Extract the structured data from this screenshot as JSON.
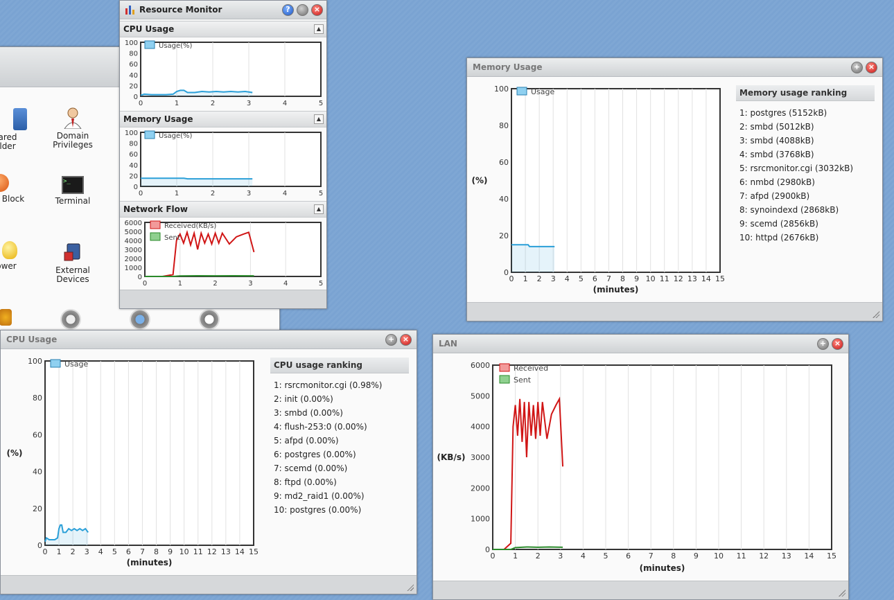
{
  "resource_monitor": {
    "title": "Resource Monitor",
    "sections": {
      "cpu": "CPU Usage",
      "memory": "Memory Usage",
      "network": "Network Flow"
    }
  },
  "desktop": {
    "icons": [
      {
        "name": "shared-folder",
        "line1": "ared",
        "line2": "lder"
      },
      {
        "name": "domain-privileges",
        "line1": "Domain",
        "line2": "Privileges"
      },
      {
        "name": "block",
        "line1": "Block",
        "line2": ""
      },
      {
        "name": "terminal",
        "line1": "Terminal",
        "line2": ""
      },
      {
        "name": "power",
        "line1": "ower",
        "line2": ""
      },
      {
        "name": "external-devices",
        "line1": "External",
        "line2": "Devices"
      }
    ]
  },
  "memory_window": {
    "title": "Memory Usage",
    "ranking_title": "Memory usage ranking",
    "ranking": [
      "1: postgres (5152kB)",
      "2: smbd (5012kB)",
      "3: smbd (4088kB)",
      "4: smbd (3768kB)",
      "5: rsrcmonitor.cgi (3032kB)",
      "6: nmbd (2980kB)",
      "7: afpd (2900kB)",
      "8: synoindexd (2868kB)",
      "9: scemd (2856kB)",
      "10: httpd (2676kB)"
    ]
  },
  "cpu_window": {
    "title": "CPU Usage",
    "ranking_title": "CPU usage ranking",
    "ranking": [
      "1: rsrcmonitor.cgi (0.98%)",
      "2: init (0.00%)",
      "3: smbd (0.00%)",
      "4: flush-253:0 (0.00%)",
      "5: afpd (0.00%)",
      "6: postgres (0.00%)",
      "7: scemd (0.00%)",
      "8: ftpd (0.00%)",
      "9: md2_raid1 (0.00%)",
      "10: postgres (0.00%)"
    ]
  },
  "lan_window": {
    "title": "LAN"
  },
  "chart_data": [
    {
      "id": "mini_cpu",
      "type": "area",
      "x_ticks": [
        0,
        1,
        2,
        3,
        4,
        5
      ],
      "y_ticks": [
        0,
        20,
        40,
        60,
        80,
        100
      ],
      "ylim": [
        0,
        100
      ],
      "xlim": [
        0,
        5
      ],
      "series": [
        {
          "name": "Usage(%)",
          "color": "#2a9fd8",
          "x": [
            0,
            0.1,
            0.3,
            0.5,
            0.7,
            0.9,
            1.0,
            1.1,
            1.2,
            1.3,
            1.5,
            1.7,
            1.9,
            2.1,
            2.3,
            2.5,
            2.7,
            2.9,
            3.1
          ],
          "y": [
            2,
            4,
            3,
            3,
            3,
            4,
            9,
            11,
            11,
            7,
            7,
            9,
            8,
            9,
            8,
            9,
            8,
            9,
            7
          ]
        }
      ]
    },
    {
      "id": "mini_mem",
      "type": "area",
      "x_ticks": [
        0,
        1,
        2,
        3,
        4,
        5
      ],
      "y_ticks": [
        0,
        20,
        40,
        60,
        80,
        100
      ],
      "ylim": [
        0,
        100
      ],
      "xlim": [
        0,
        5
      ],
      "series": [
        {
          "name": "Usage(%)",
          "color": "#2a9fd8",
          "x": [
            0,
            0.5,
            1.0,
            1.2,
            1.3,
            1.5,
            2.0,
            2.5,
            3.1
          ],
          "y": [
            15,
            15,
            15,
            15,
            14,
            14,
            14,
            14,
            14
          ]
        }
      ]
    },
    {
      "id": "mini_net",
      "type": "line",
      "x_ticks": [
        0,
        1,
        2,
        3,
        4,
        5
      ],
      "y_ticks": [
        0,
        1000,
        2000,
        3000,
        4000,
        5000,
        6000
      ],
      "ylim": [
        0,
        6000
      ],
      "xlim": [
        0,
        5
      ],
      "series": [
        {
          "name": "Received(KB/s)",
          "color": "#d01515",
          "x": [
            0,
            0.5,
            0.8,
            0.9,
            1.0,
            1.1,
            1.2,
            1.3,
            1.4,
            1.5,
            1.6,
            1.7,
            1.8,
            1.9,
            2.0,
            2.1,
            2.2,
            2.4,
            2.6,
            2.8,
            2.95,
            3.1
          ],
          "y": [
            0,
            0,
            200,
            4000,
            4700,
            3700,
            4900,
            3500,
            4800,
            3000,
            4800,
            3700,
            4700,
            3600,
            4800,
            3700,
            4800,
            3600,
            4400,
            4700,
            4900,
            2700
          ]
        },
        {
          "name": "Sent",
          "color": "#2a8a2a",
          "x": [
            0,
            0.8,
            1.0,
            1.5,
            2.0,
            2.5,
            3.1
          ],
          "y": [
            0,
            0,
            60,
            80,
            70,
            80,
            70
          ]
        }
      ]
    },
    {
      "id": "big_mem",
      "type": "area",
      "ylabel": "(%)",
      "xlabel": "(minutes)",
      "x_ticks": [
        0,
        1,
        2,
        3,
        4,
        5,
        6,
        7,
        8,
        9,
        10,
        11,
        12,
        13,
        14,
        15
      ],
      "y_ticks": [
        0,
        20,
        40,
        60,
        80,
        100
      ],
      "ylim": [
        0,
        100
      ],
      "xlim": [
        0,
        15
      ],
      "series": [
        {
          "name": "Usage",
          "color": "#2a9fd8",
          "x": [
            0,
            0.5,
            1.0,
            1.2,
            1.3,
            1.5,
            2.0,
            2.5,
            3.1
          ],
          "y": [
            15,
            15,
            15,
            15,
            14,
            14,
            14,
            14,
            14
          ]
        }
      ]
    },
    {
      "id": "big_cpu",
      "type": "area",
      "ylabel": "(%)",
      "xlabel": "(minutes)",
      "x_ticks": [
        0,
        1,
        2,
        3,
        4,
        5,
        6,
        7,
        8,
        9,
        10,
        11,
        12,
        13,
        14,
        15
      ],
      "y_ticks": [
        0,
        20,
        40,
        60,
        80,
        100
      ],
      "ylim": [
        0,
        100
      ],
      "xlim": [
        0,
        15
      ],
      "series": [
        {
          "name": "Usage",
          "color": "#2a9fd8",
          "x": [
            0,
            0.1,
            0.3,
            0.5,
            0.7,
            0.9,
            1.0,
            1.1,
            1.2,
            1.3,
            1.5,
            1.7,
            1.9,
            2.1,
            2.3,
            2.5,
            2.7,
            2.9,
            3.1
          ],
          "y": [
            2,
            4,
            3,
            3,
            3,
            4,
            9,
            11,
            11,
            7,
            7,
            9,
            8,
            9,
            8,
            9,
            8,
            9,
            7
          ]
        }
      ]
    },
    {
      "id": "big_lan",
      "type": "line",
      "ylabel": "(KB/s)",
      "xlabel": "(minutes)",
      "x_ticks": [
        0,
        1,
        2,
        3,
        4,
        5,
        6,
        7,
        8,
        9,
        10,
        11,
        12,
        13,
        14,
        15
      ],
      "y_ticks": [
        0,
        1000,
        2000,
        3000,
        4000,
        5000,
        6000
      ],
      "ylim": [
        0,
        6000
      ],
      "xlim": [
        0,
        15
      ],
      "series": [
        {
          "name": "Received",
          "color": "#d01515",
          "x": [
            0,
            0.5,
            0.8,
            0.9,
            1.0,
            1.1,
            1.2,
            1.3,
            1.4,
            1.5,
            1.6,
            1.7,
            1.8,
            1.9,
            2.0,
            2.1,
            2.2,
            2.4,
            2.6,
            2.8,
            2.95,
            3.1
          ],
          "y": [
            0,
            0,
            200,
            4000,
            4700,
            3700,
            4900,
            3500,
            4800,
            3000,
            4800,
            3700,
            4700,
            3600,
            4800,
            3700,
            4800,
            3600,
            4400,
            4700,
            4900,
            2700
          ]
        },
        {
          "name": "Sent",
          "color": "#2a8a2a",
          "x": [
            0,
            0.8,
            1.0,
            1.5,
            2.0,
            2.5,
            3.1
          ],
          "y": [
            0,
            0,
            60,
            80,
            70,
            80,
            70
          ]
        }
      ]
    }
  ]
}
